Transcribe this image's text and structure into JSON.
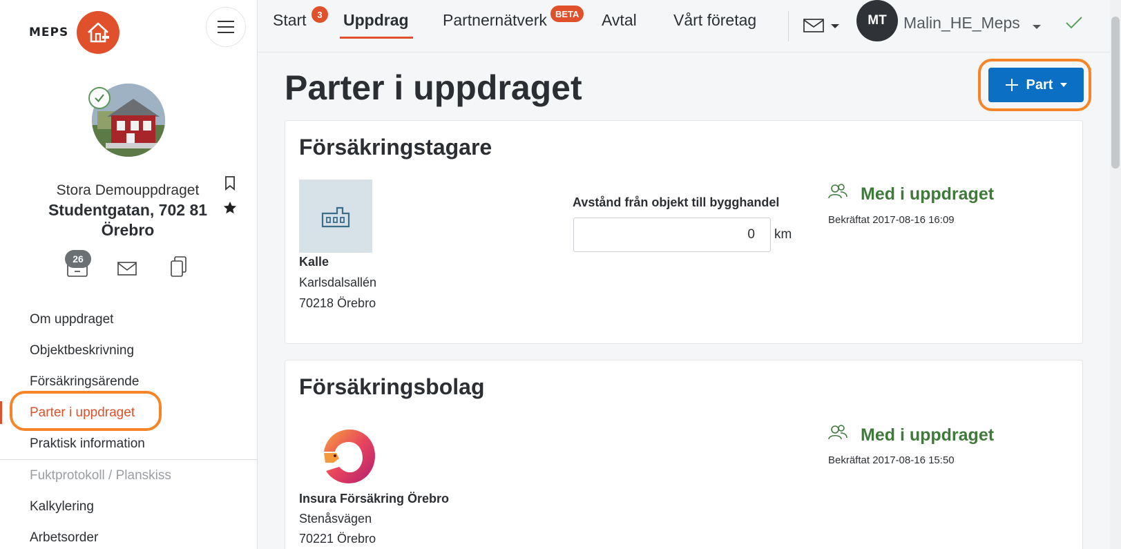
{
  "app": {
    "logo_text": "MEPS",
    "brand_color": "#e0502a",
    "primary_color": "#0b6fc3"
  },
  "sidebar": {
    "case_name": "Stora Demouppdraget",
    "case_address": "Studentgatan, 702 81 Örebro",
    "message_count": "26",
    "nav": [
      {
        "label": "Om uppdraget",
        "state": "normal"
      },
      {
        "label": "Objektbeskrivning",
        "state": "normal"
      },
      {
        "label": "Försäkringsärende",
        "state": "normal"
      },
      {
        "label": "Parter i uppdraget",
        "state": "active"
      },
      {
        "label": "Praktisk information",
        "state": "normal"
      },
      {
        "label": "Fuktprotokoll / Planskiss",
        "state": "disabled"
      },
      {
        "label": "Kalkylering",
        "state": "normal"
      },
      {
        "label": "Arbetsorder",
        "state": "normal"
      }
    ]
  },
  "topnav": {
    "start": "Start",
    "start_badge": "3",
    "uppdrag": "Uppdrag",
    "partner": "Partnernätverk",
    "partner_badge": "BETA",
    "avtal": "Avtal",
    "foretag": "Vårt företag",
    "user_initials": "MT",
    "user_name": "Malin_HE_Meps"
  },
  "main": {
    "title": "Parter i uppdraget",
    "add_button": "Part",
    "cards": {
      "policyholder": {
        "title": "Försäkringstagare",
        "name": "Kalle",
        "street": "Karlsdalsallén",
        "city": "70218 Örebro",
        "distance_label": "Avstånd från objekt till bygghandel",
        "distance_value": "0",
        "distance_unit": "km",
        "status": "Med i uppdraget",
        "confirmed": "Bekräftat 2017-08-16 16:09"
      },
      "insurer": {
        "title": "Försäkringsbolag",
        "name": "Insura Försäkring Örebro",
        "street": "Stenåsvägen",
        "city": "70221 Örebro",
        "status": "Med i uppdraget",
        "confirmed": "Bekräftat 2017-08-16 15:50"
      }
    }
  }
}
